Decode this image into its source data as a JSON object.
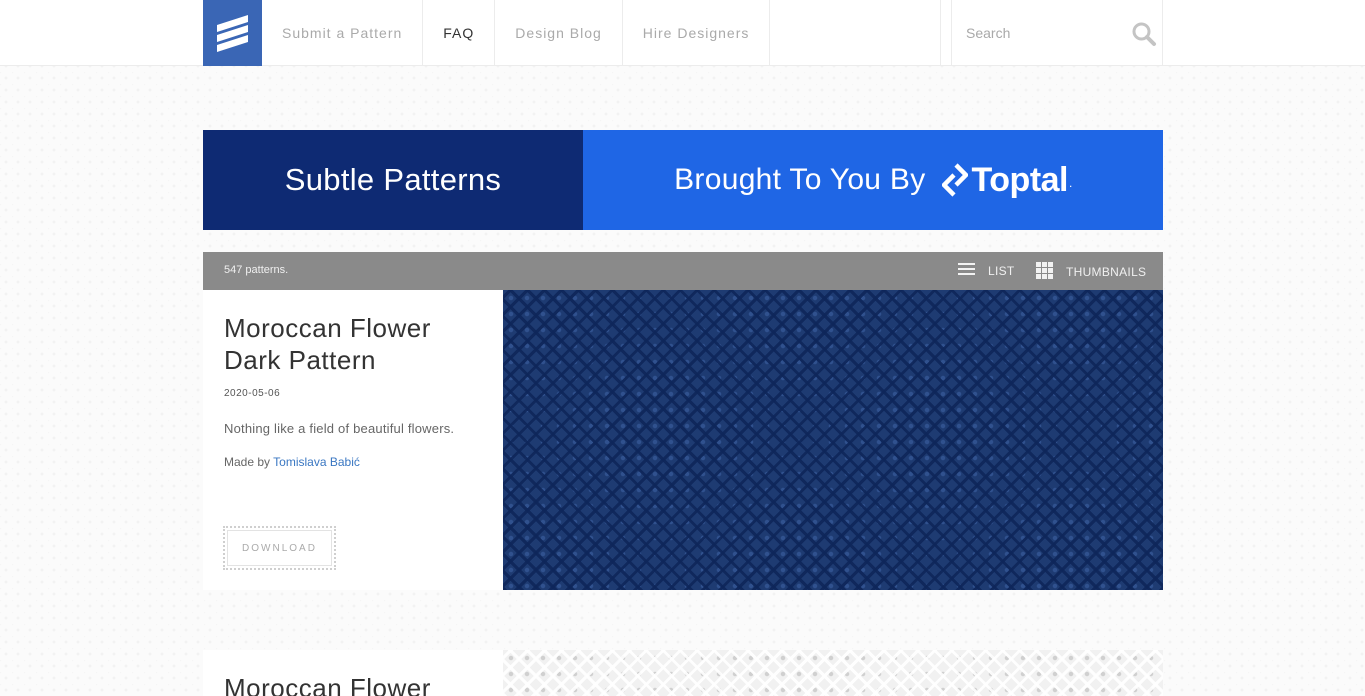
{
  "header": {
    "logo_icon": "stripes-logo-icon",
    "nav": [
      {
        "label": "Submit a Pattern",
        "active": false
      },
      {
        "label": "FAQ",
        "active": true
      },
      {
        "label": "Design Blog",
        "active": false
      },
      {
        "label": "Hire Designers",
        "active": false
      }
    ],
    "search": {
      "placeholder": "Search",
      "value": "",
      "icon": "search-icon"
    }
  },
  "banner": {
    "left_text": "Subtle Patterns",
    "right_text": "Brought To You By",
    "brand_name": "Toptal",
    "brand_suffix": ".",
    "colors": {
      "left_bg": "#0e2a73",
      "right_bg": "#1f66e5"
    }
  },
  "toolbar": {
    "count": "547 patterns.",
    "list_label": "LIST",
    "thumbnails_label": "THUMBNAILS"
  },
  "patterns": [
    {
      "title": "Moroccan Flower Dark Pattern",
      "date": "2020-05-06",
      "description": "Nothing like a field of beautiful flowers.",
      "made_by_prefix": "Made by ",
      "author": "Tomislava Babić",
      "download_label": "DOWNLOAD",
      "preview_color": "#1e3b72"
    },
    {
      "title": "Moroccan Flower",
      "preview_color": "#f1f1f1"
    }
  ]
}
